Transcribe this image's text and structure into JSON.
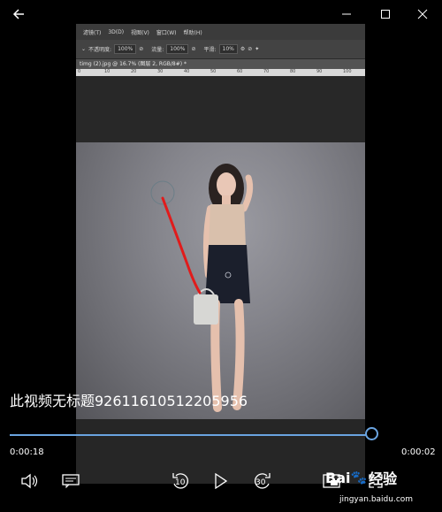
{
  "player": {
    "title": "此视频无标题92611610512205956",
    "elapsed": "0:00:18",
    "remaining": "0:00:02",
    "progress": 0.96,
    "skip_back_seconds": "10",
    "skip_forward_seconds": "30",
    "accent_color": "#6aa4e0"
  },
  "video_frame": {
    "menu_items": [
      "滤镜(T)",
      "3D(D)",
      "视图(V)",
      "窗口(W)",
      "帮助(H)"
    ],
    "options_bar": {
      "opacity_label": "不透明度:",
      "opacity_value": "100%",
      "flow_label": "流量:",
      "flow_value": "100%",
      "smoothing_label": "平滑:",
      "smoothing_value": "10%"
    },
    "doc_tab": "timg (2).jpg @ 16.7% (图层 2, RGB/8#) *",
    "ruler_ticks": [
      "0",
      "10",
      "20",
      "30",
      "40",
      "50",
      "60",
      "70",
      "80",
      "90",
      "100"
    ]
  },
  "watermark": {
    "brand_a": "Bai",
    "brand_b": "经验",
    "url": "jingyan.baidu.com"
  },
  "icons": [
    "back-arrow-icon",
    "minimize-icon",
    "maximize-icon",
    "close-icon",
    "volume-icon",
    "captions-icon",
    "skip-back-icon",
    "play-icon",
    "skip-forward-icon",
    "mini-view-icon",
    "fullscreen-icon"
  ]
}
